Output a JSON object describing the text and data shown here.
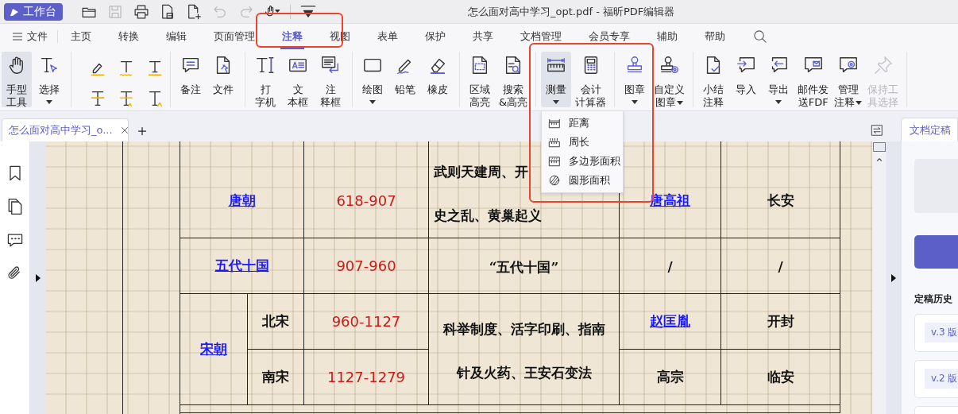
{
  "title_bar": {
    "workbench_button": "工作台",
    "title": "怎么面对高中学习_opt.pdf - 福昕PDF编辑器",
    "quick_access": [
      {
        "disabled": false
      },
      {
        "disabled": true
      },
      {
        "disabled": false
      },
      {
        "disabled": false
      },
      {
        "disabled": false
      },
      {
        "disabled": true
      },
      {
        "disabled": true
      },
      {
        "disabled": false
      },
      {
        "disabled": false
      }
    ]
  },
  "menu_bar": {
    "file_menu": "文件",
    "tabs": [
      {
        "label": "主页",
        "selected": false
      },
      {
        "label": "转换",
        "selected": false
      },
      {
        "label": "编辑",
        "selected": false
      },
      {
        "label": "页面管理",
        "selected": false
      },
      {
        "label": "注释",
        "selected": true
      },
      {
        "label": "视图",
        "selected": false
      },
      {
        "label": "表单",
        "selected": false
      },
      {
        "label": "保护",
        "selected": false
      },
      {
        "label": "共享",
        "selected": false
      },
      {
        "label": "文档管理",
        "selected": false
      },
      {
        "label": "会员专享",
        "selected": false
      },
      {
        "label": "辅助",
        "selected": false
      },
      {
        "label": "帮助",
        "selected": false
      }
    ]
  },
  "ribbon": {
    "groups": [
      {
        "kind": "tools",
        "items": [
          {
            "lines": [
              "手型",
              "工具"
            ],
            "selected": true,
            "disabled": false
          },
          {
            "lines": [
              "选择"
            ],
            "dropdown": true,
            "selected": false,
            "disabled": false
          }
        ]
      },
      {
        "kind": "markup"
      },
      {
        "kind": "tools",
        "items": [
          {
            "lines": [
              "备注"
            ],
            "selected": false,
            "disabled": false
          },
          {
            "lines": [
              "文件"
            ],
            "selected": false,
            "disabled": false
          }
        ]
      },
      {
        "kind": "tools",
        "items": [
          {
            "lines": [
              "打",
              "字机"
            ],
            "selected": false,
            "disabled": false
          },
          {
            "lines": [
              "文",
              "本框"
            ],
            "selected": false,
            "disabled": false
          },
          {
            "lines": [
              "注",
              "释框"
            ],
            "selected": false,
            "disabled": false
          }
        ]
      },
      {
        "kind": "tools",
        "items": [
          {
            "lines": [
              "绘图"
            ],
            "dropdown": true,
            "selected": false,
            "disabled": false
          },
          {
            "lines": [
              "铅笔"
            ],
            "selected": false,
            "disabled": false
          },
          {
            "lines": [
              "橡皮"
            ],
            "selected": false,
            "disabled": false
          }
        ]
      },
      {
        "kind": "tools",
        "items": [
          {
            "lines": [
              "区域",
              "高亮"
            ],
            "selected": false,
            "disabled": false
          },
          {
            "lines": [
              "搜索",
              "&高亮"
            ],
            "selected": false,
            "disabled": false
          }
        ]
      },
      {
        "kind": "tools",
        "items": [
          {
            "lines": [
              "测量"
            ],
            "dropdown": true,
            "selected": true,
            "disabled": false
          },
          {
            "lines": [
              "会计",
              "计算器"
            ],
            "selected": false,
            "disabled": false
          }
        ]
      },
      {
        "kind": "tools",
        "items": [
          {
            "lines": [
              "图章"
            ],
            "dropdown": true,
            "selected": false,
            "disabled": false
          },
          {
            "lines": [
              "自定义",
              "图章"
            ],
            "dropdown": true,
            "dropdown_inline": true,
            "selected": false,
            "disabled": false
          }
        ]
      },
      {
        "kind": "tools",
        "items": [
          {
            "lines": [
              "小结",
              "注释"
            ],
            "selected": false,
            "disabled": false
          },
          {
            "lines": [
              "导入"
            ],
            "selected": false,
            "disabled": false
          },
          {
            "lines": [
              "导出"
            ],
            "dropdown": true,
            "selected": false,
            "disabled": false
          },
          {
            "lines": [
              "邮件发",
              "送FDF"
            ],
            "selected": false,
            "disabled": false
          },
          {
            "lines": [
              "管理",
              "注释"
            ],
            "dropdown": true,
            "dropdown_inline": true,
            "selected": false,
            "disabled": false
          },
          {
            "lines": [
              "保持工",
              "具选择"
            ],
            "selected": false,
            "disabled": true
          }
        ]
      }
    ]
  },
  "measure_menu": {
    "items": [
      {
        "label": "距离"
      },
      {
        "label": "周长"
      },
      {
        "label": "多边形面积"
      },
      {
        "label": "圆形面积"
      }
    ]
  },
  "document_tabs": [
    {
      "title": "怎么面对高中学习_o...",
      "selected": true
    }
  ],
  "document": {
    "dynasties": [
      {
        "name": "唐朝",
        "link": true,
        "events": [
          "武则天建周、开",
          "史之乱、黄巢起义"
        ],
        "periods": [
          {
            "years": "618-907",
            "founder": "唐高祖",
            "founder_link": true,
            "capital": "长安"
          }
        ]
      },
      {
        "name": "五代十国",
        "link": true,
        "events": [
          "“五代十国”"
        ],
        "periods": [
          {
            "years": "907-960",
            "founder": "/",
            "founder_link": false,
            "capital": "/"
          }
        ]
      },
      {
        "name": "宋朝",
        "link": true,
        "events": [
          "科举制度、活字印刷、指南",
          "针及火药、王安石变法"
        ],
        "periods": [
          {
            "name": "北宋",
            "years": "960-1127",
            "founder": "赵匡胤",
            "founder_link": true,
            "capital": "开封"
          },
          {
            "name": "南宋",
            "years": "1127-1279",
            "founder": "高宗",
            "founder_link": false,
            "capital": "临安"
          }
        ]
      }
    ]
  },
  "right_panel": {
    "tab": {
      "label": "文档定稿",
      "selected": true
    },
    "history_title": "定稿历史",
    "versions": [
      {
        "label": "v.3 版"
      },
      {
        "label": "v.2 版"
      }
    ]
  }
}
